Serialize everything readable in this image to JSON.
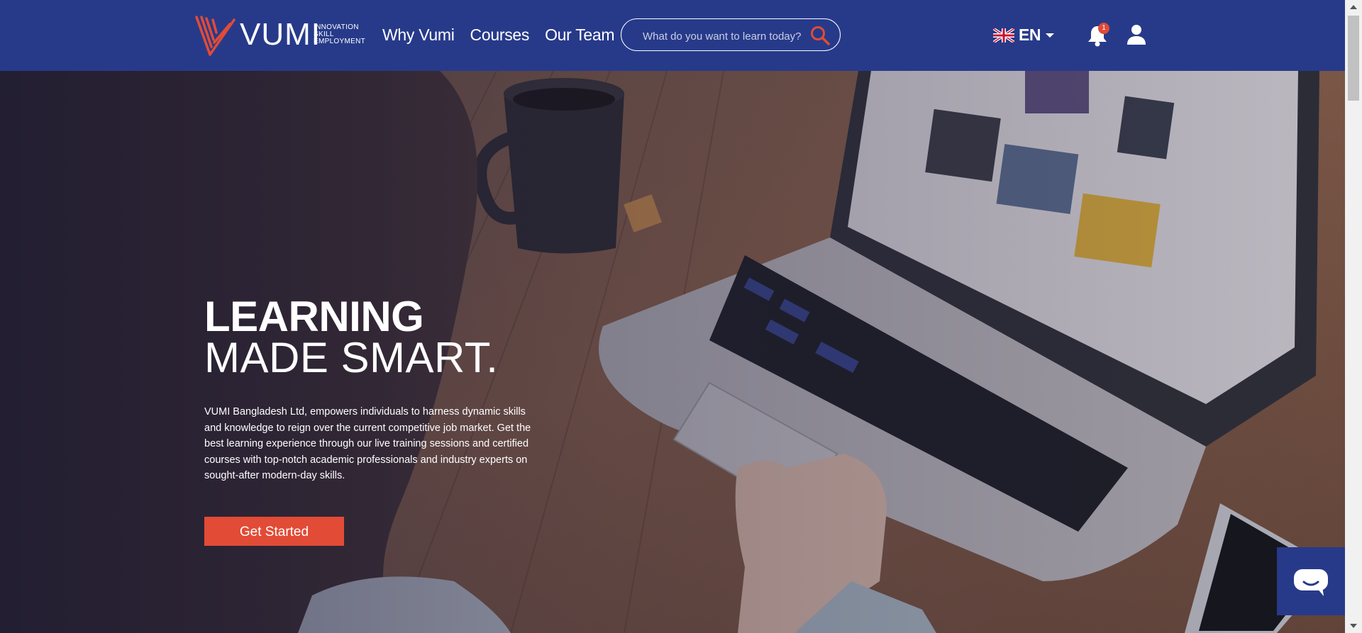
{
  "header": {
    "logo": {
      "word": "VUMI",
      "tagline": [
        "INNOVATION",
        "SKILL",
        "EMPLOYMENT"
      ],
      "mark_icon": "vumi-logo-mark"
    },
    "nav": [
      {
        "label": "Why Vumi"
      },
      {
        "label": "Courses"
      },
      {
        "label": "Our Team"
      }
    ],
    "search": {
      "placeholder": "What do you want to learn today?",
      "value": "",
      "icon": "search-icon"
    },
    "language": {
      "code": "EN",
      "flag_icon": "uk-flag-icon",
      "caret_icon": "chevron-down-icon"
    },
    "notifications": {
      "icon": "bell-icon",
      "count": "1"
    },
    "account": {
      "icon": "user-icon"
    }
  },
  "hero": {
    "headline_line1": "LEARNING",
    "headline_line2": "MADE SMART.",
    "description": "VUMI Bangladesh Ltd, empowers individuals to harness dynamic skills and knowledge to reign over the current competitive job market. Get the best learning experience through our live training sessions and certified courses with top-notch academic professionals and industry experts on sought-after modern-day skills.",
    "cta_label": "Get Started"
  },
  "chat_widget": {
    "icon": "chat-bubble-icon"
  },
  "colors": {
    "header_bg": "#273a8a",
    "accent": "#e24b36",
    "text_light": "#ffffff"
  }
}
